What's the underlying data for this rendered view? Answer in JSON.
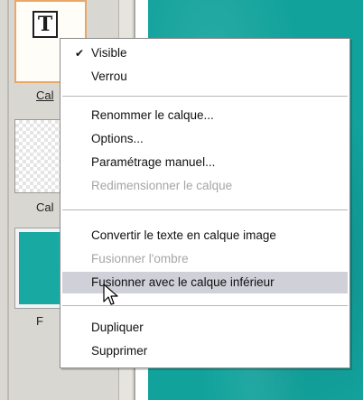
{
  "layers_panel": {
    "layers": [
      {
        "name": "Cal",
        "thumbnail": "text-layer-icon"
      },
      {
        "name": "Cal",
        "thumbnail": "transparent-checker"
      },
      {
        "name": "F",
        "thumbnail": "teal-image"
      }
    ],
    "text_layer_glyph": "T"
  },
  "canvas": {
    "fill_color": "#12a29c"
  },
  "context_menu": {
    "groups": [
      {
        "items": [
          {
            "label": "Visible",
            "checked": true,
            "disabled": false
          },
          {
            "label": "Verrou",
            "checked": false,
            "disabled": false
          }
        ]
      },
      {
        "items": [
          {
            "label": "Renommer le calque...",
            "disabled": false
          },
          {
            "label": "Options...",
            "disabled": false
          },
          {
            "label": "Paramétrage manuel...",
            "disabled": false
          },
          {
            "label": "Redimensionner le calque",
            "disabled": true
          }
        ]
      },
      {
        "items": [
          {
            "label": "Convertir le texte en calque image",
            "disabled": false
          },
          {
            "label": "Fusionner l'ombre",
            "disabled": true
          },
          {
            "label": "Fusionner avec le calque inférieur",
            "disabled": false,
            "highlighted": true
          }
        ]
      },
      {
        "items": [
          {
            "label": "Dupliquer",
            "disabled": false
          },
          {
            "label": "Supprimer",
            "disabled": false
          }
        ]
      }
    ],
    "check_glyph": "✔",
    "highlight_color": "#cfd0d8"
  },
  "cursor": {
    "icon": "hand-pointer-icon"
  }
}
